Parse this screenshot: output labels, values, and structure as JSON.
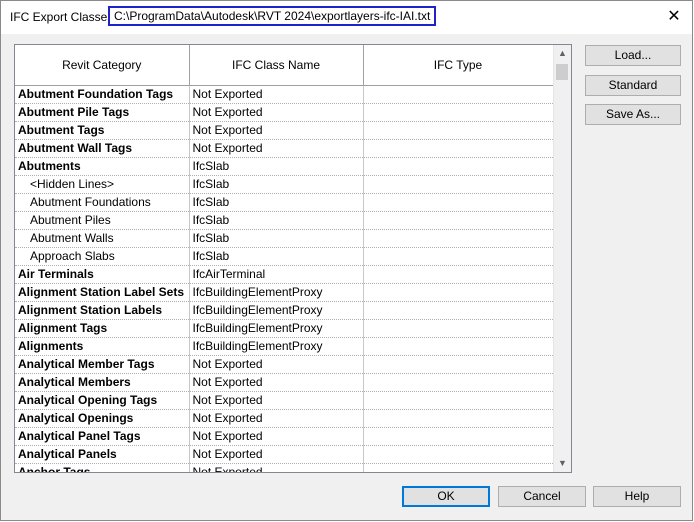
{
  "titlebar": {
    "label": "IFC Export Classes:",
    "path": "C:\\ProgramData\\Autodesk\\RVT 2024\\exportlayers-ifc-IAI.txt",
    "close_glyph": "✕"
  },
  "table": {
    "headers": [
      "Revit Category",
      "IFC Class Name",
      "IFC Type"
    ],
    "rows": [
      {
        "category": "Abutment Foundation Tags",
        "ifc_class": "Not Exported",
        "ifc_type": "",
        "sub": false
      },
      {
        "category": "Abutment Pile Tags",
        "ifc_class": "Not Exported",
        "ifc_type": "",
        "sub": false
      },
      {
        "category": "Abutment Tags",
        "ifc_class": "Not Exported",
        "ifc_type": "",
        "sub": false
      },
      {
        "category": "Abutment Wall Tags",
        "ifc_class": "Not Exported",
        "ifc_type": "",
        "sub": false
      },
      {
        "category": "Abutments",
        "ifc_class": "IfcSlab",
        "ifc_type": "",
        "sub": false
      },
      {
        "category": "<Hidden Lines>",
        "ifc_class": "IfcSlab",
        "ifc_type": "",
        "sub": true
      },
      {
        "category": "Abutment Foundations",
        "ifc_class": "IfcSlab",
        "ifc_type": "",
        "sub": true
      },
      {
        "category": "Abutment Piles",
        "ifc_class": "IfcSlab",
        "ifc_type": "",
        "sub": true
      },
      {
        "category": "Abutment Walls",
        "ifc_class": "IfcSlab",
        "ifc_type": "",
        "sub": true
      },
      {
        "category": "Approach Slabs",
        "ifc_class": "IfcSlab",
        "ifc_type": "",
        "sub": true
      },
      {
        "category": "Air Terminals",
        "ifc_class": "IfcAirTerminal",
        "ifc_type": "",
        "sub": false
      },
      {
        "category": "Alignment Station Label Sets",
        "ifc_class": "IfcBuildingElementProxy",
        "ifc_type": "",
        "sub": false
      },
      {
        "category": "Alignment Station Labels",
        "ifc_class": "IfcBuildingElementProxy",
        "ifc_type": "",
        "sub": false
      },
      {
        "category": "Alignment Tags",
        "ifc_class": "IfcBuildingElementProxy",
        "ifc_type": "",
        "sub": false
      },
      {
        "category": "Alignments",
        "ifc_class": "IfcBuildingElementProxy",
        "ifc_type": "",
        "sub": false
      },
      {
        "category": "Analytical Member Tags",
        "ifc_class": "Not Exported",
        "ifc_type": "",
        "sub": false
      },
      {
        "category": "Analytical Members",
        "ifc_class": "Not Exported",
        "ifc_type": "",
        "sub": false
      },
      {
        "category": "Analytical Opening Tags",
        "ifc_class": "Not Exported",
        "ifc_type": "",
        "sub": false
      },
      {
        "category": "Analytical Openings",
        "ifc_class": "Not Exported",
        "ifc_type": "",
        "sub": false
      },
      {
        "category": "Analytical Panel Tags",
        "ifc_class": "Not Exported",
        "ifc_type": "",
        "sub": false
      },
      {
        "category": "Analytical Panels",
        "ifc_class": "Not Exported",
        "ifc_type": "",
        "sub": false
      },
      {
        "category": "Anchor Tags",
        "ifc_class": "Not Exported",
        "ifc_type": "",
        "sub": false
      }
    ]
  },
  "scrollbar": {
    "up_glyph": "▲",
    "down_glyph": "▼"
  },
  "side_buttons": {
    "load": "Load...",
    "standard": "Standard",
    "save_as": "Save As..."
  },
  "footer_buttons": {
    "ok": "OK",
    "cancel": "Cancel",
    "help": "Help"
  }
}
